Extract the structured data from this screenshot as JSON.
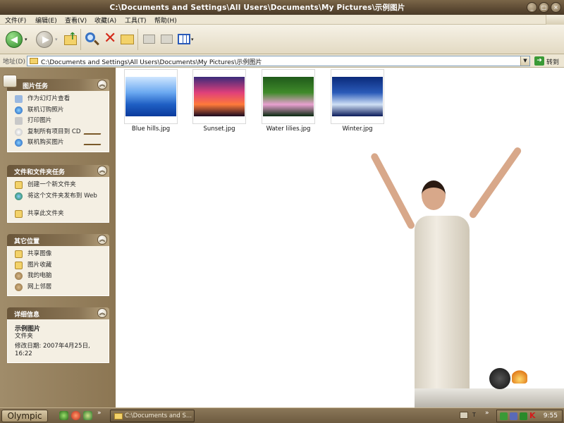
{
  "window": {
    "title": "C:\\Documents and Settings\\All Users\\Documents\\My Pictures\\示例图片"
  },
  "menu": [
    "文件(F)",
    "编辑(E)",
    "查看(V)",
    "收藏(A)",
    "工具(T)",
    "帮助(H)"
  ],
  "address": {
    "label": "地址(D)",
    "value": "C:\\Documents and Settings\\All Users\\Documents\\My Pictures\\示例图片",
    "go_label": "转到"
  },
  "panels": {
    "picture_tasks": {
      "title": "图片任务",
      "items": [
        "作为幻灯片查看",
        "联机订购照片",
        "打印图片",
        "复制所有项目到 CD",
        "联机购买图片"
      ]
    },
    "file_tasks": {
      "title": "文件和文件夹任务",
      "items": [
        "创建一个新文件夹",
        "将这个文件夹发布到 Web",
        "共享此文件夹"
      ]
    },
    "other_places": {
      "title": "其它位置",
      "items": [
        "共享图像",
        "图片收藏",
        "我的电脑",
        "网上邻居"
      ]
    },
    "details": {
      "title": "详细信息",
      "name": "示例图片",
      "type": "文件夹",
      "modified": "修改日期: 2007年4月25日, 16:22"
    }
  },
  "files": [
    {
      "name": "Blue hills.jpg",
      "palette": [
        "#cfe6ff",
        "#6aa8f0",
        "#1f5fc4",
        "#0b3a9c"
      ]
    },
    {
      "name": "Sunset.jpg",
      "palette": [
        "#3a2a7a",
        "#e0407a",
        "#ff7a3a",
        "#1a0a20"
      ]
    },
    {
      "name": "Water lilies.jpg",
      "palette": [
        "#1f5a1a",
        "#3f8a2a",
        "#e8a0d0",
        "#0a2a10"
      ]
    },
    {
      "name": "Winter.jpg",
      "palette": [
        "#0a2a7a",
        "#2a5ab8",
        "#cfe0f5",
        "#0a1a5a"
      ]
    }
  ],
  "taskbar": {
    "start_label": "Olympic",
    "task_label": "C:\\Documents and S...",
    "clock": "9:55"
  },
  "colors": {
    "chrome_dark": "#5c4a33",
    "chrome_light": "#ede6d3",
    "pane": "#8c7653"
  }
}
